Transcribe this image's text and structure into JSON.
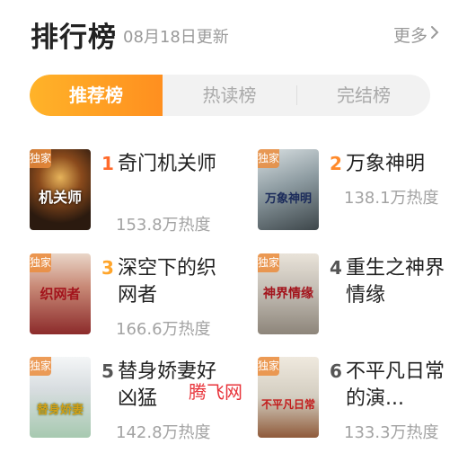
{
  "header": {
    "title": "排行榜",
    "updated": "08月18日更新",
    "more": "更多"
  },
  "tabs": [
    {
      "label": "推荐榜",
      "active": true
    },
    {
      "label": "热读榜",
      "active": false
    },
    {
      "label": "完结榜",
      "active": false
    }
  ],
  "books": [
    {
      "rank": "1",
      "name": "奇门机关师",
      "heat": "153.8万热度",
      "badge": "独家",
      "cover_text": "机关师",
      "rank_color": "#ff6a2b",
      "cover_bg": "#2b1a0f"
    },
    {
      "rank": "2",
      "name": "万象神明",
      "heat": "138.1万热度",
      "badge": "独家",
      "cover_text": "万象神明",
      "rank_color": "#ff8a2b",
      "cover_bg": "#7c8a8f"
    },
    {
      "rank": "3",
      "name": "深空下的织网者",
      "heat": "166.6万热度",
      "badge": "独家",
      "cover_text": "织网者",
      "rank_color": "#ffa52b",
      "cover_bg": "#8c2b2b"
    },
    {
      "rank": "4",
      "name": "重生之神界情缘",
      "heat": "",
      "badge": "独家",
      "cover_text": "神界情缘",
      "rank_color": "#555555",
      "cover_bg": "#bfb9b0"
    },
    {
      "rank": "5",
      "name": "替身娇妻好凶猛",
      "heat": "142.8万热度",
      "badge": "独家",
      "cover_text": "替身娇妻",
      "rank_color": "#555555",
      "cover_bg": "#d8dde0"
    },
    {
      "rank": "6",
      "name": "不平凡日常的演...",
      "heat": "133.3万热度",
      "badge": "独家",
      "cover_text": "不平凡日常",
      "rank_color": "#555555",
      "cover_bg": "#d3cdc0"
    }
  ],
  "watermark": "腾飞网",
  "colors": {
    "accent": "#ff9c24",
    "muted": "#a3a3a3"
  }
}
